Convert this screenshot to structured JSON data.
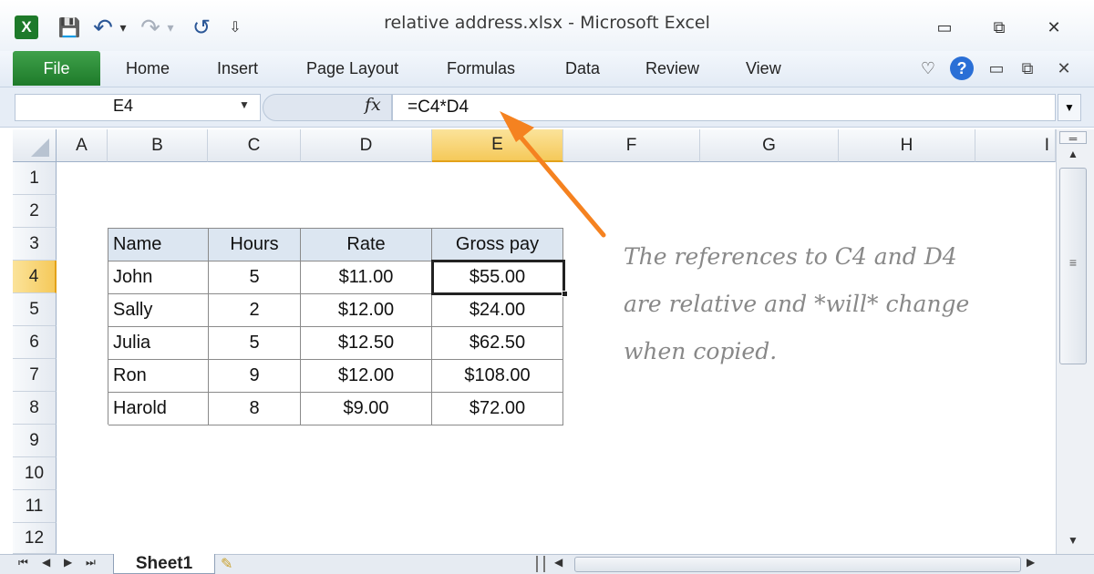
{
  "window": {
    "title": "relative address.xlsx  -  Microsoft Excel"
  },
  "qat": {
    "app_icon": "X",
    "save": "💾",
    "undo": "↶",
    "undo_drop": "▾",
    "redo": "↷",
    "redo_drop": "▾",
    "repeat": "↺",
    "customize": "⇩"
  },
  "window_controls": {
    "minimize": "▭",
    "restore": "⧉",
    "close": "✕"
  },
  "ribbon": {
    "file": "File",
    "tabs": [
      "Home",
      "Insert",
      "Page Layout",
      "Formulas",
      "Data",
      "Review",
      "View"
    ],
    "right_icons": {
      "favorite": "♡",
      "help": "?",
      "minimize": "▭",
      "restore": "⧉",
      "close": "✕"
    }
  },
  "formula_bar": {
    "name_box": "E4",
    "fx": "fx",
    "formula": "=C4*D4"
  },
  "columns": [
    "A",
    "B",
    "C",
    "D",
    "E",
    "F",
    "G",
    "H",
    "I"
  ],
  "rows": [
    "1",
    "2",
    "3",
    "4",
    "5",
    "6",
    "7",
    "8",
    "9",
    "10",
    "11",
    "12"
  ],
  "table": {
    "headers": [
      "Name",
      "Hours",
      "Rate",
      "Gross pay"
    ],
    "rows": [
      [
        "John",
        "5",
        "$11.00",
        "$55.00"
      ],
      [
        "Sally",
        "2",
        "$12.00",
        "$24.00"
      ],
      [
        "Julia",
        "5",
        "$12.50",
        "$62.50"
      ],
      [
        "Ron",
        "9",
        "$12.00",
        "$108.00"
      ],
      [
        "Harold",
        "8",
        "$9.00",
        "$72.00"
      ]
    ]
  },
  "annotation": {
    "line1": "The references to C4 and D4",
    "line2": "are relative and *will* change",
    "line3": "when copied."
  },
  "sheets": {
    "active": "Sheet1"
  },
  "colors": {
    "arrow": "#f58220",
    "selected_header": "#f5c95a",
    "table_header": "#dce6f1"
  }
}
